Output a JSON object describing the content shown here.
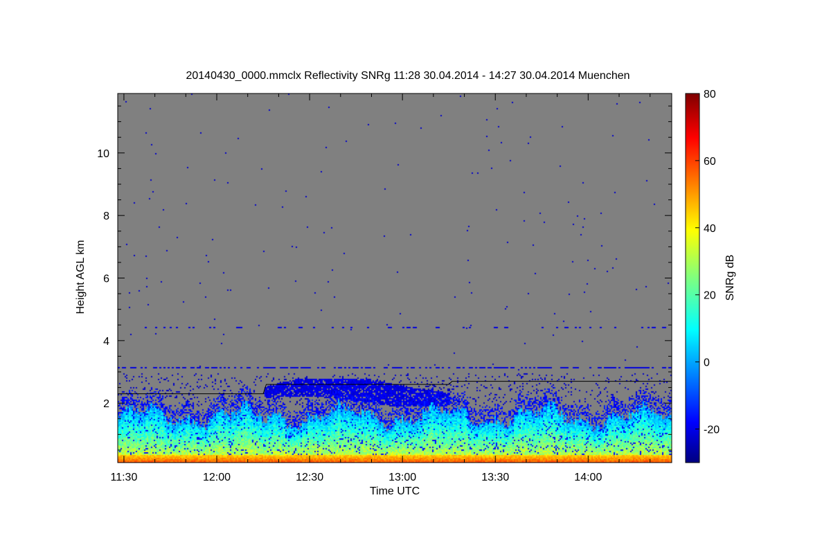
{
  "chart_data": {
    "type": "heatmap",
    "title": "20140430_0000.mmclx Reflectivity SNRg   11:28 30.04.2014 - 14:27 30.04.2014 Muenchen",
    "xlabel": "Time UTC",
    "ylabel": "Height AGL km",
    "xlim": [
      "11:28",
      "14:27"
    ],
    "ylim": [
      0.1,
      11.9
    ],
    "x_ticks": [
      "11:30",
      "12:00",
      "12:30",
      "13:00",
      "13:30",
      "14:00"
    ],
    "y_ticks": [
      2,
      4,
      6,
      8,
      10
    ],
    "colorbar": {
      "label": "SNRg dB",
      "range": [
        -30,
        80
      ],
      "ticks": [
        -20,
        0,
        20,
        40,
        60,
        80
      ],
      "colormap": "jet"
    },
    "background_color": "#808080",
    "features": {
      "surface_layer_km": [
        0.1,
        0.35
      ],
      "boundary_layer_top_km": 1.6,
      "cloud_layer_km": [
        1.9,
        2.8
      ],
      "cloud_time_range": [
        "12:15",
        "13:15"
      ],
      "noise_line_km": [
        3.15,
        4.45
      ],
      "reference_line": [
        {
          "time": "11:28",
          "height_km": 2.3
        },
        {
          "time": "12:15",
          "height_km": 2.3
        },
        {
          "time": "12:16",
          "height_km": 2.6
        },
        {
          "time": "13:15",
          "height_km": 2.6
        },
        {
          "time": "13:16",
          "height_km": 2.7
        },
        {
          "time": "14:27",
          "height_km": 2.7
        }
      ]
    },
    "grid": false
  }
}
